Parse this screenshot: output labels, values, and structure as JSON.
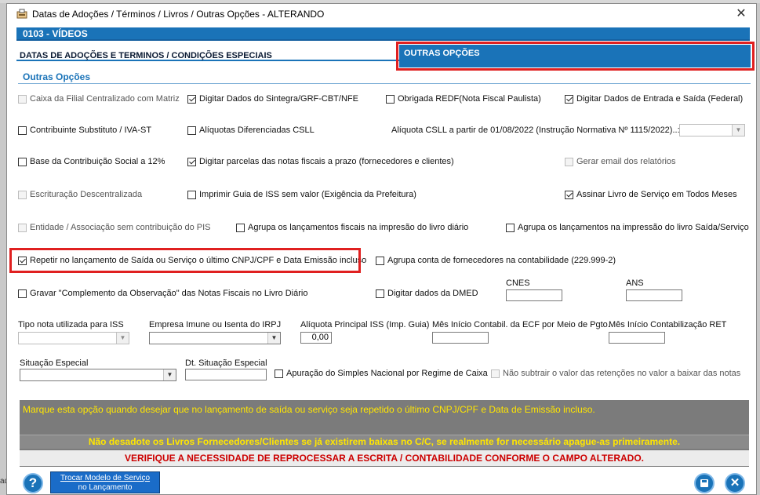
{
  "window": {
    "title": "Datas de Adoções / Términos / Livros / Outras Opções  -  ALTERANDO",
    "close_glyph": "✕"
  },
  "header": {
    "record": "0103  -  VÍDEOS"
  },
  "tabs": [
    {
      "label": "DATAS DE ADOÇÕES E TERMINOS / CONDIÇÕES ESPECIAIS",
      "active": false
    },
    {
      "label": "OUTRAS OPÇÕES",
      "active": true
    }
  ],
  "section": {
    "title": "Outras Opções"
  },
  "options": {
    "caixa_filial": {
      "label": "Caixa da Filial Centralizado com Matriz",
      "checked": false,
      "enabled": false
    },
    "digitar_sintegra": {
      "label": "Digitar Dados do Sintegra/GRF-CBT/NFE",
      "checked": true,
      "enabled": true
    },
    "obrigada_redf": {
      "label": "Obrigada REDF(Nota Fiscal Paulista)",
      "checked": false,
      "enabled": true
    },
    "digitar_entrada_saida": {
      "label": "Digitar Dados de Entrada e Saída (Federal)",
      "checked": true,
      "enabled": true
    },
    "contribuinte_substituto": {
      "label": "Contribuinte Substituto / IVA-ST",
      "checked": false,
      "enabled": true
    },
    "aliquotas_csll": {
      "label": "Alíquotas Diferenciadas CSLL",
      "checked": false,
      "enabled": true
    },
    "base_contribuicao": {
      "label": "Base da Contribuição Social a 12%",
      "checked": false,
      "enabled": true
    },
    "digitar_parcelas": {
      "label": "Digitar parcelas das notas fiscais a prazo (fornecedores e clientes)",
      "checked": true,
      "enabled": true
    },
    "gerar_email": {
      "label": "Gerar email dos relatórios",
      "checked": false,
      "enabled": false
    },
    "escrituracao_descentralizada": {
      "label": "Escrituração Descentralizada",
      "checked": false,
      "enabled": false
    },
    "imprimir_guia_iss": {
      "label": "Imprimir Guia de ISS sem valor (Exigência da Prefeitura)",
      "checked": false,
      "enabled": true
    },
    "assinar_livro_servico": {
      "label": "Assinar Livro de Serviço em Todos Meses",
      "checked": true,
      "enabled": true
    },
    "entidade_associacao": {
      "label": "Entidade / Associação sem contribuição do PIS",
      "checked": false,
      "enabled": false
    },
    "agrupa_fiscais_diario": {
      "label": "Agrupa os lançamentos fiscais na impresão do livro diário",
      "checked": false,
      "enabled": true
    },
    "agrupa_saida_servico": {
      "label": "Agrupa os lançamentos na impressão do livro Saída/Serviço",
      "checked": false,
      "enabled": true
    },
    "repetir_cnpj": {
      "label": "Repetir no lançamento de Saída ou Serviço o último CNPJ/CPF e Data Emissão incluso",
      "checked": true,
      "enabled": true
    },
    "agrupa_fornecedores": {
      "label": "Agrupa conta de fornecedores na contabilidade (229.999-2)",
      "checked": false,
      "enabled": true
    },
    "gravar_complemento": {
      "label": "Gravar \"Complemento da Observação\" das Notas Fiscais no Livro Diário",
      "checked": false,
      "enabled": true
    },
    "digitar_dmed": {
      "label": "Digitar dados da DMED",
      "checked": false,
      "enabled": true
    },
    "apuracao_simples": {
      "label": "Apuração do Simples Nacional por Regime de Caixa",
      "checked": false,
      "enabled": true
    },
    "nao_subtrair_retencoes": {
      "label": "Não subtrair o valor das retenções no valor a baixar das notas",
      "checked": false,
      "enabled": false
    }
  },
  "fields": {
    "aliquota_csll_label": "Alíquota CSLL a partir de 01/08/2022 (Instrução Normativa Nº 1115/2022)..:",
    "cnes_label": "CNES",
    "ans_label": "ANS",
    "tipo_nota_label": "Tipo nota utilizada para ISS",
    "empresa_imune_label": "Empresa Imune ou Isenta do IRPJ",
    "aliquota_iss_label": "Alíquota Principal ISS (Imp. Guia)",
    "aliquota_iss_value": "0,00",
    "mes_ecf_label": "Mês Início Contabil. da ECF por Meio de Pgto.",
    "mes_ret_label": "Mês Início Contabilização RET",
    "situacao_especial_label": "Situação Especial",
    "dt_situacao_label": "Dt. Situação Especial"
  },
  "messages": {
    "hint": "Marque esta opção quando desejar que no lançamento de saída ou serviço seja repetido o último CNPJ/CPF e Data de Emissão incluso.",
    "warning": "Não desadote os Livros Fornecedores/Clientes se já existirem baixas no C/C, se realmente for necessário apague-as primeiramente.",
    "alert": "VERIFIQUE A NECESSIDADE DE REPROCESSAR A ESCRITA / CONTABILIDADE CONFORME O CAMPO ALTERADO."
  },
  "footer": {
    "help_label": "?",
    "trocar_line1": "Trocar Modelo de Serviço",
    "trocar_line2": "no Lançamento",
    "exit_label": "✕",
    "edge_text": "ada"
  },
  "colors": {
    "accent_blue": "#1a73b8",
    "highlight_red": "#e02020",
    "hint_yellow": "#ffe600",
    "alert_red": "#cc0000"
  }
}
